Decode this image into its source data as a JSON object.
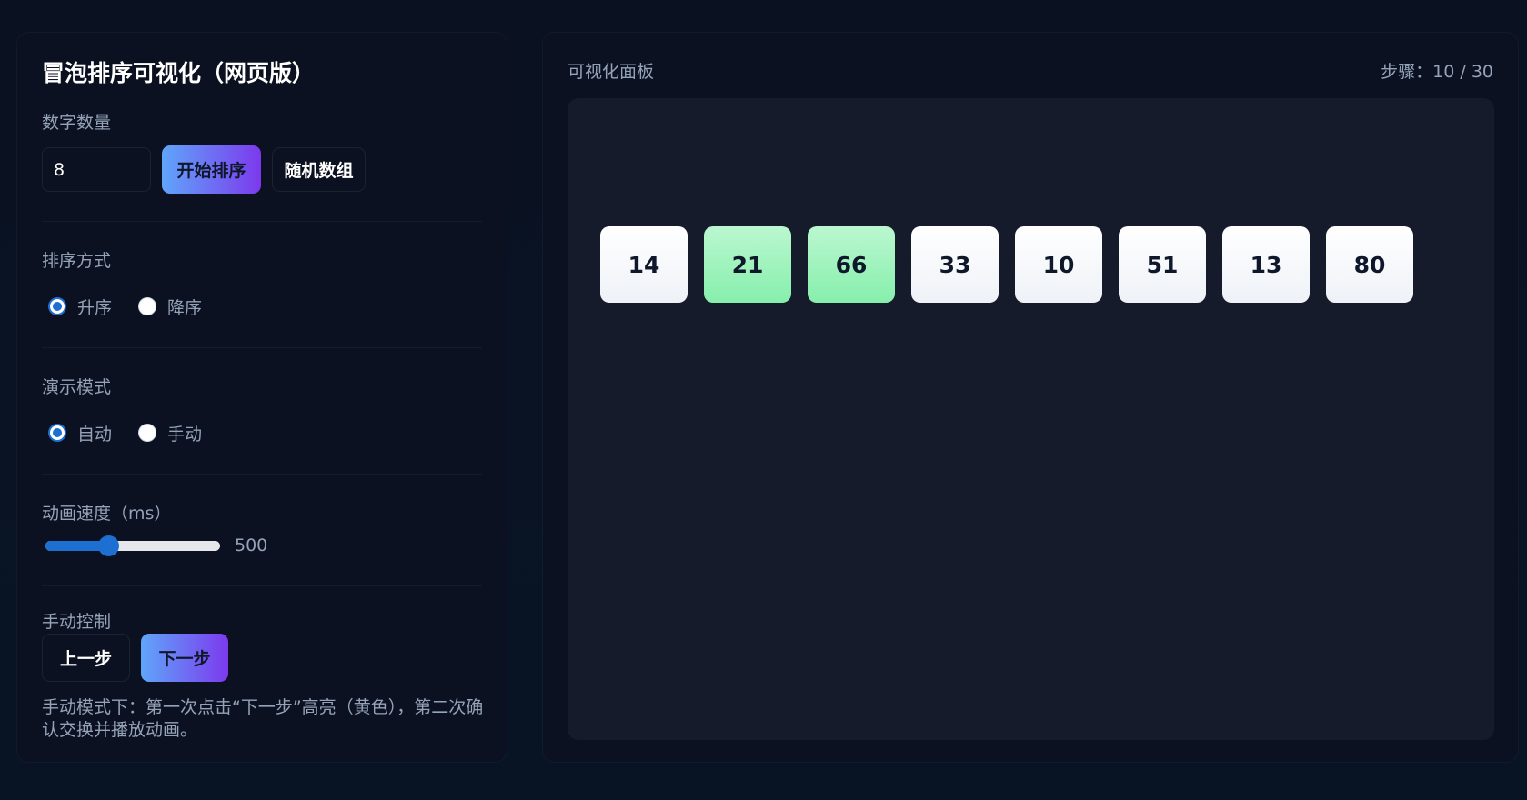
{
  "app": {
    "title": "冒泡排序可视化（网页版）"
  },
  "controls": {
    "count_label": "数字数量",
    "count_value": "8",
    "start_button": "开始排序",
    "random_button": "随机数组",
    "order_label": "排序方式",
    "order_options": [
      {
        "label": "升序",
        "checked": true
      },
      {
        "label": "降序",
        "checked": false
      }
    ],
    "mode_label": "演示模式",
    "mode_options": [
      {
        "label": "自动",
        "checked": true
      },
      {
        "label": "手动",
        "checked": false
      }
    ],
    "speed_label": "动画速度（ms）",
    "speed_value": "500",
    "speed_fraction": 0.36,
    "manual_label": "手动控制",
    "prev_button": "上一步",
    "next_button": "下一步",
    "help_text": "手动模式下：第一次点击“下一步”高亮（黄色），第二次确认交换并播放动画。"
  },
  "visual": {
    "title": "可视化面板",
    "steps": "步骤：10 / 30",
    "cards": [
      {
        "value": "14",
        "active": false
      },
      {
        "value": "21",
        "active": true
      },
      {
        "value": "66",
        "active": true
      },
      {
        "value": "33",
        "active": false
      },
      {
        "value": "10",
        "active": false
      },
      {
        "value": "51",
        "active": false
      },
      {
        "value": "13",
        "active": false
      },
      {
        "value": "80",
        "active": false
      }
    ]
  },
  "colors": {
    "accent": "#1d6fd1",
    "gradient_start": "#60a5fa",
    "gradient_end": "#7c3aed",
    "active_card": "#86efac"
  }
}
